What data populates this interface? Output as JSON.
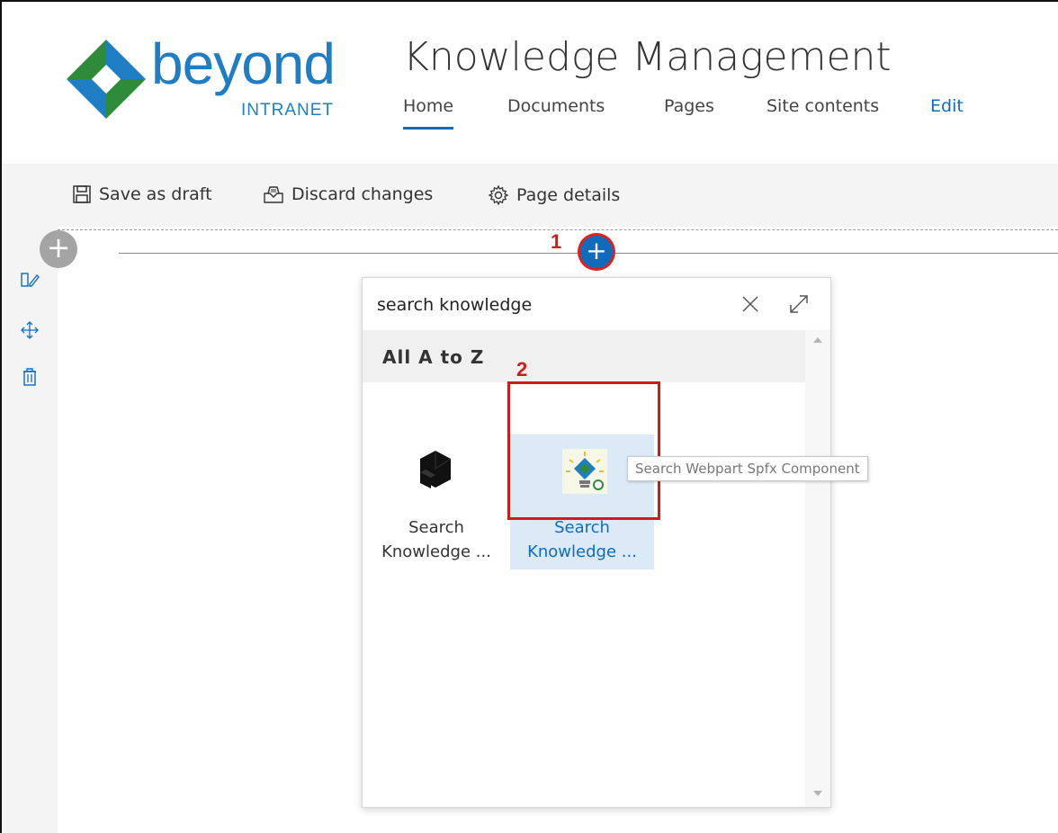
{
  "brand": {
    "logo_word": "beyond",
    "logo_sub": "INTRANET",
    "primary_color": "#1f7dc3",
    "accent_green": "#2e8b3a"
  },
  "site": {
    "title": "Knowledge Management"
  },
  "nav": {
    "items": [
      {
        "label": "Home",
        "active": true
      },
      {
        "label": "Documents",
        "active": false
      },
      {
        "label": "Pages",
        "active": false
      },
      {
        "label": "Site contents",
        "active": false
      },
      {
        "label": "Edit",
        "active": false
      }
    ]
  },
  "toolbar": {
    "save_label": "Save as draft",
    "discard_label": "Discard changes",
    "details_label": "Page details"
  },
  "annotations": {
    "step1": "1",
    "step2": "2",
    "color": "#d11a1a"
  },
  "picker": {
    "search_value": "search knowledge",
    "section_title": "All A to Z",
    "tiles": [
      {
        "label_line1": "Search",
        "label_line2": "Knowledge ...",
        "icon": "cube-icon",
        "selected": false
      },
      {
        "label_line1": "Search",
        "label_line2": "Knowledge ...",
        "icon": "lightbulb-puzzle-icon",
        "selected": true
      }
    ],
    "tooltip": "Search Webpart Spfx Component"
  },
  "left_tools": [
    "edit-section-icon",
    "move-icon",
    "trash-icon"
  ]
}
